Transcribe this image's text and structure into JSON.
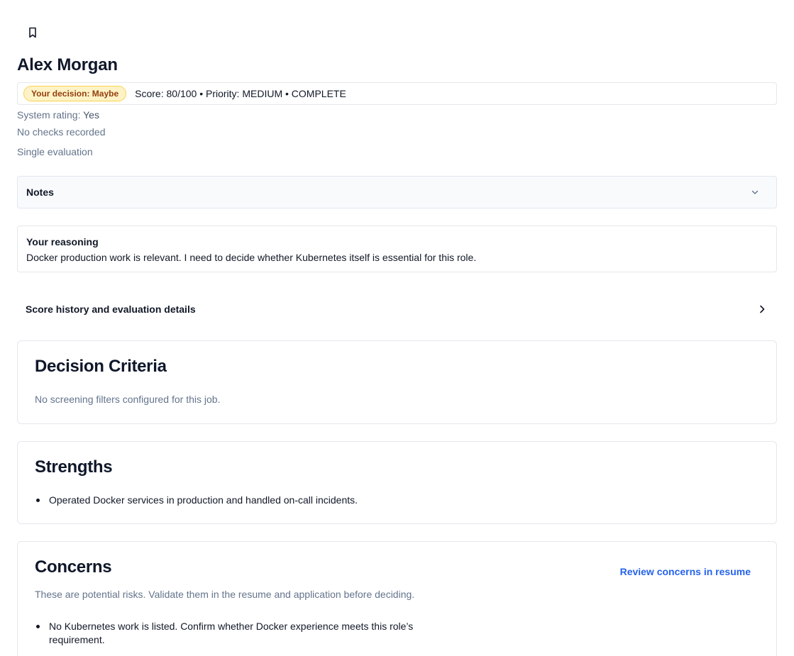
{
  "header": {
    "bookmark_icon": "bookmark-icon",
    "candidate_name": "Alex Morgan"
  },
  "status": {
    "decision_badge": "Your decision: Maybe",
    "summary": "Score: 80/100 • Priority: MEDIUM • COMPLETE"
  },
  "meta": {
    "system_rating_label": "System rating:",
    "system_rating_value": "Yes",
    "checks": "No checks recorded",
    "evaluation_type": "Single evaluation"
  },
  "notes": {
    "label": "Notes",
    "toggle_icon": "chevron-down-icon"
  },
  "reasoning": {
    "title": "Your reasoning",
    "text": "Docker production work is relevant. I need to decide whether Kubernetes itself is essential for this role."
  },
  "history": {
    "label": "Score history and evaluation details",
    "toggle_icon": "chevron-right-icon"
  },
  "decision_criteria": {
    "title": "Decision Criteria",
    "text": "No screening filters configured for this job."
  },
  "strengths": {
    "title": "Strengths",
    "items": [
      "Operated Docker services in production and handled on-call incidents."
    ]
  },
  "concerns": {
    "title": "Concerns",
    "link": "Review concerns in resume",
    "subtitle": "These are potential risks. Validate them in the resume and application before deciding.",
    "items": [
      "No Kubernetes work is listed. Confirm whether Docker experience meets this role’s requirement."
    ]
  },
  "colors": {
    "decision_badge_bg": "#fef3c7",
    "decision_badge_text": "#92400e",
    "link": "#2563eb",
    "muted_text": "#64748b"
  }
}
